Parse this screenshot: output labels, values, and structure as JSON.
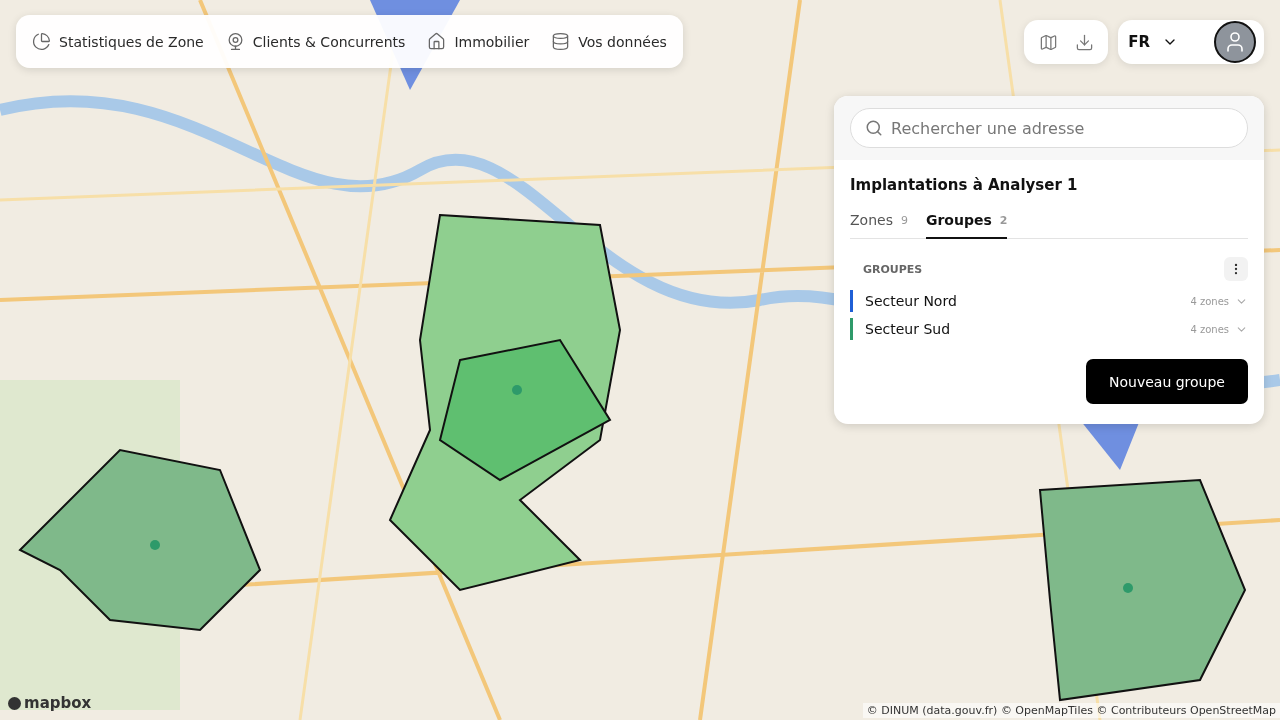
{
  "nav": [
    {
      "label": "Statistiques de Zone"
    },
    {
      "label": "Clients & Concurrents"
    },
    {
      "label": "Immobilier"
    },
    {
      "label": "Vos données"
    }
  ],
  "tools": {
    "language": "FR"
  },
  "panel": {
    "search": {
      "placeholder": "Rechercher une adresse"
    },
    "title": "Implantations à Analyser 1",
    "tabs": [
      {
        "label": "Zones",
        "count": "9",
        "selected": false
      },
      {
        "label": "Groupes",
        "count": "2",
        "selected": true
      }
    ],
    "section": "GROUPES",
    "groups": [
      {
        "name": "Secteur Nord",
        "count": "4 zones",
        "color": "#1f5fd6"
      },
      {
        "name": "Secteur Sud",
        "count": "4 zones",
        "color": "#2e9a6a"
      }
    ],
    "button": "Nouveau groupe"
  },
  "logo": "mapbox",
  "attribution": "© DINUM (data.gouv.fr) © OpenMapTiles © Contributeurs OpenStreetMap"
}
